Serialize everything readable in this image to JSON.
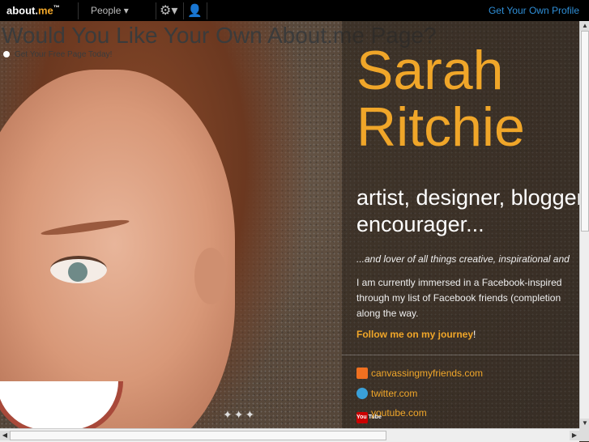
{
  "topbar": {
    "logo_main": "about.",
    "logo_accent": "me",
    "logo_tm": "™",
    "people_label": "People ▾",
    "settings_icon": "gear-icon",
    "user_icon": "add-user-icon",
    "get_profile": "Get Your Own Profile"
  },
  "overlay": {
    "title": "Would You Like Your Own About.me Page?",
    "subtitle": "Get Your Free Page Today!"
  },
  "profile": {
    "name_first": "Sarah",
    "name_last": "Ritchie",
    "tagline_line1": "artist, designer, blogger,",
    "tagline_line2": "encourager...",
    "lover": "...and lover of all things creative, inspirational and",
    "bio_line1": "I am currently immersed in a Facebook-inspired",
    "bio_line2": "through my list of Facebook friends (completion",
    "bio_line3": "along the way.",
    "follow": "Follow me on my journey",
    "follow_bang": "!",
    "links": [
      {
        "label": "canvassingmyfriends.com",
        "icon": "canvas-icon"
      },
      {
        "label": "twitter.com",
        "icon": "twitter-icon"
      },
      {
        "label": "youtube.com",
        "icon": "youtube-icon",
        "icon_text": "You Tube"
      }
    ]
  },
  "colors": {
    "accent": "#f0a629",
    "link_blue": "#2f8fd8",
    "topbar_bg": "#000000"
  }
}
